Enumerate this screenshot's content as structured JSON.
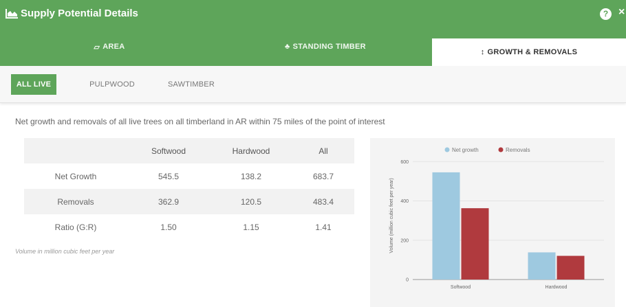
{
  "window": {
    "title": "Supply Potential Details",
    "title_icon": "area-chart-icon",
    "help_icon": "question-icon",
    "close_icon": "close-icon",
    "help_glyph": "?",
    "close_glyph": "×"
  },
  "tabs": [
    {
      "label": "AREA",
      "icon": "area-icon",
      "glyph": "▱"
    },
    {
      "label": "STANDING TIMBER",
      "icon": "tree-icon",
      "glyph": "♣"
    },
    {
      "label": "GROWTH & REMOVALS",
      "icon": "arrows-vertical-icon",
      "glyph": "↕",
      "active": true
    }
  ],
  "subtabs": [
    {
      "label": "ALL LIVE",
      "active": true
    },
    {
      "label": "PULPWOOD"
    },
    {
      "label": "SAWTIMBER"
    }
  ],
  "description": "Net growth and removals of all live trees on all timberland in AR within 75 miles of the point of interest",
  "table": {
    "headers": [
      "",
      "Softwood",
      "Hardwood",
      "All"
    ],
    "rows": [
      {
        "label": "Net Growth",
        "values": [
          "545.5",
          "138.2",
          "683.7"
        ]
      },
      {
        "label": "Removals",
        "values": [
          "362.9",
          "120.5",
          "483.4"
        ]
      },
      {
        "label": "Ratio (G:R)",
        "values": [
          "1.50",
          "1.15",
          "1.41"
        ]
      }
    ],
    "footnote": "Volume in million cubic feet per year"
  },
  "colors": {
    "brand_green": "#5ea55a",
    "net_growth": "#9ec9e0",
    "removals": "#b03a3e"
  },
  "chart_data": {
    "type": "bar",
    "categories": [
      "Softwood",
      "Hardwood"
    ],
    "series": [
      {
        "name": "Net growth",
        "values": [
          545.5,
          138.2
        ],
        "color": "#9ec9e0"
      },
      {
        "name": "Removals",
        "values": [
          362.9,
          120.5
        ],
        "color": "#b03a3e"
      }
    ],
    "ylabel": "Volume (million cubic feet per year)",
    "yticks": [
      0,
      200,
      400,
      600
    ],
    "ylim": [
      0,
      650
    ],
    "legend": "top"
  }
}
